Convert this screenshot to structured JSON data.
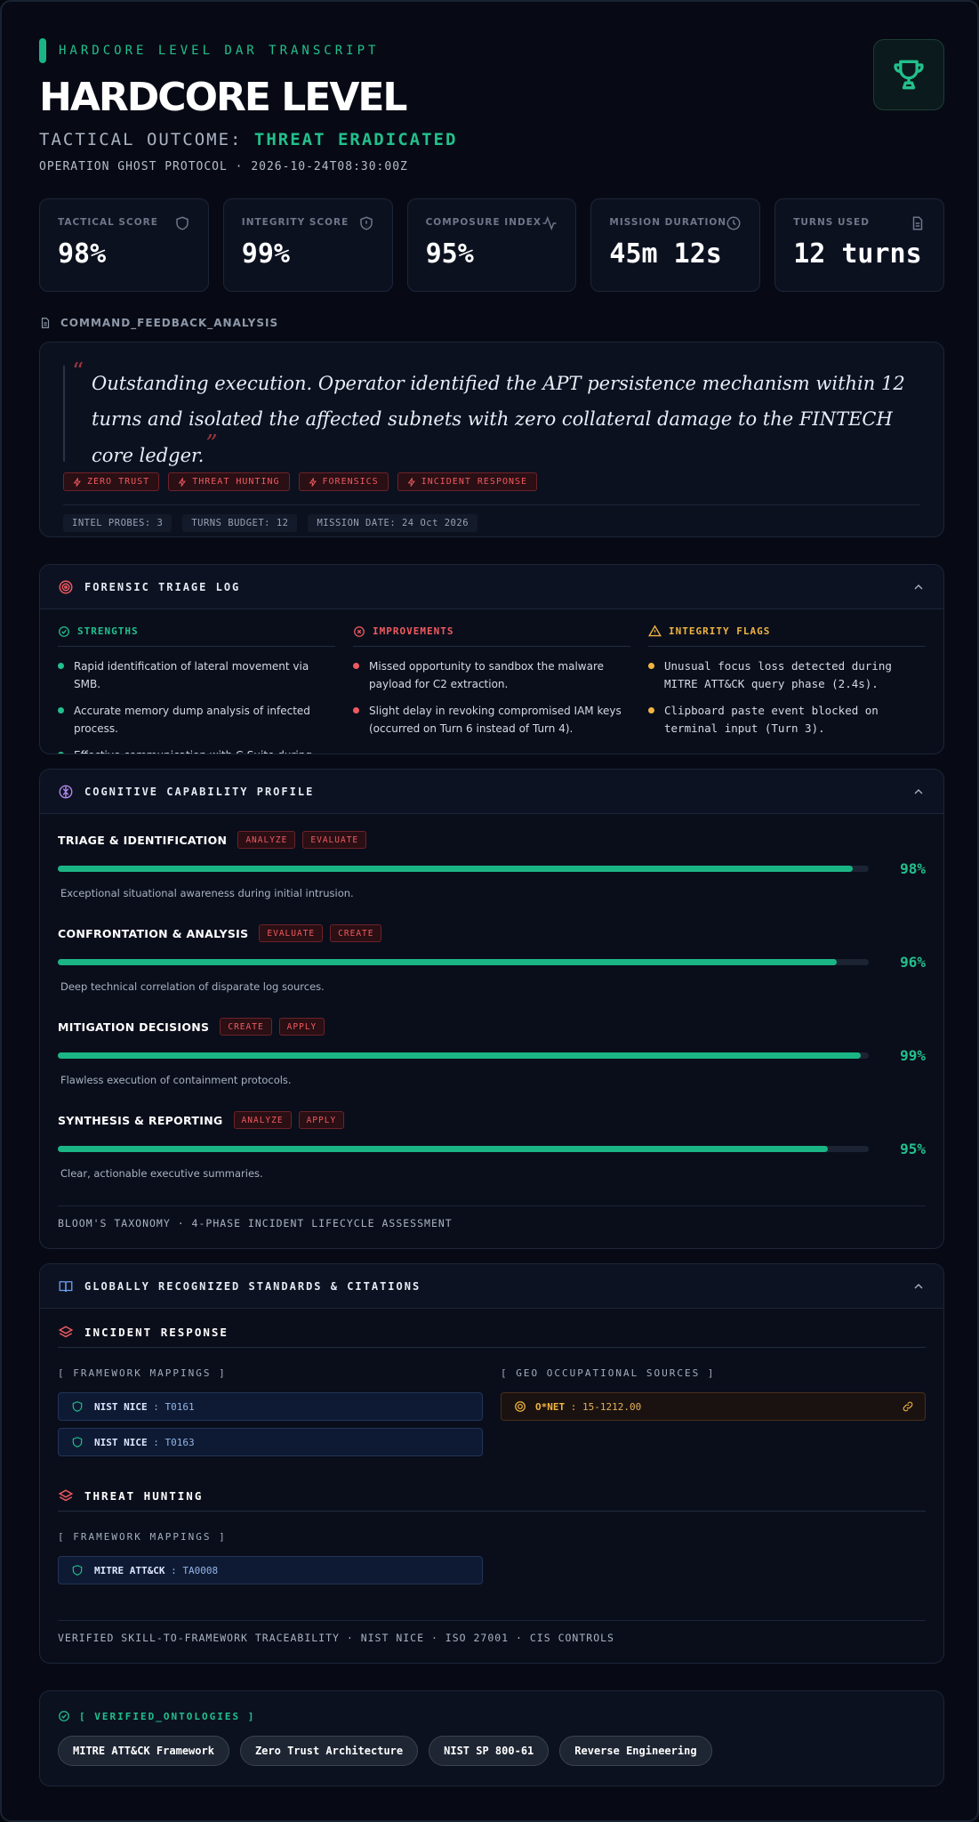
{
  "header": {
    "eyebrow": "HARDCORE LEVEL DAR TRANSCRIPT",
    "title": "HARDCORE LEVEL",
    "outcome_label": "TACTICAL OUTCOME:",
    "outcome_value": "THREAT ERADICATED",
    "operation_line": "OPERATION GHOST PROTOCOL · 2026-10-24T08:30:00Z",
    "accent_color": "#22c08c"
  },
  "stats": [
    {
      "label": "TACTICAL SCORE",
      "value": "98%",
      "icon": "shield-icon"
    },
    {
      "label": "INTEGRITY SCORE",
      "value": "99%",
      "icon": "shield-alert-icon"
    },
    {
      "label": "COMPOSURE INDEX",
      "value": "95%",
      "icon": "activity-icon"
    },
    {
      "label": "MISSION DURATION",
      "value": "45m 12s",
      "icon": "clock-icon"
    },
    {
      "label": "TURNS USED",
      "value": "12 turns",
      "icon": "document-icon"
    }
  ],
  "feedback": {
    "section_label": "COMMAND_FEEDBACK_ANALYSIS",
    "quote_open": "“",
    "quote_close": "”",
    "quote": "Outstanding execution. Operator identified the APT persistence mechanism within 12 turns and isolated the affected subnets with zero collateral damage to the FINTECH core ledger.",
    "tags": [
      "ZERO TRUST",
      "THREAT HUNTING",
      "FORENSICS",
      "INCIDENT RESPONSE"
    ],
    "meta": [
      "INTEL PROBES: 3",
      "TURNS BUDGET: 12",
      "MISSION DATE: 24 Oct 2026"
    ]
  },
  "triage": {
    "title": "FORENSIC TRIAGE LOG",
    "strengths": {
      "title": "STRENGTHS",
      "color": "#22c08c",
      "items": [
        "Rapid identification of lateral movement via SMB.",
        "Accurate memory dump analysis of infected process.",
        "Effective communication with C-Suite during crisis."
      ]
    },
    "improvements": {
      "title": "IMPROVEMENTS",
      "color": "#ef5a5f",
      "items": [
        "Missed opportunity to sandbox the malware payload for C2 extraction.",
        "Slight delay in revoking compromised IAM keys (occurred on Turn 6 instead of Turn 4)."
      ]
    },
    "flags": {
      "title": "INTEGRITY FLAGS",
      "color": "#f0b440",
      "items": [
        "Unusual focus loss detected during MITRE ATT&CK query phase (2.4s).",
        "Clipboard paste event blocked on terminal input (Turn 3)."
      ]
    }
  },
  "cognitive": {
    "title": "COGNITIVE CAPABILITY PROFILE",
    "skills": [
      {
        "name": "TRIAGE & IDENTIFICATION",
        "chips": [
          "ANALYZE",
          "EVALUATE"
        ],
        "percent": 98,
        "percent_label": "98%",
        "desc": "Exceptional situational awareness during initial intrusion."
      },
      {
        "name": "CONFRONTATION & ANALYSIS",
        "chips": [
          "EVALUATE",
          "CREATE"
        ],
        "percent": 96,
        "percent_label": "96%",
        "desc": "Deep technical correlation of disparate log sources."
      },
      {
        "name": "MITIGATION DECISIONS",
        "chips": [
          "CREATE",
          "APPLY"
        ],
        "percent": 99,
        "percent_label": "99%",
        "desc": "Flawless execution of containment protocols."
      },
      {
        "name": "SYNTHESIS & REPORTING",
        "chips": [
          "ANALYZE",
          "APPLY"
        ],
        "percent": 95,
        "percent_label": "95%",
        "desc": "Clear, actionable executive summaries."
      }
    ],
    "footer": "BLOOM'S TAXONOMY · 4-PHASE INCIDENT LIFECYCLE ASSESSMENT"
  },
  "standards": {
    "title": "GLOBALLY RECOGNIZED STANDARDS & CITATIONS",
    "groups": [
      {
        "name": "INCIDENT RESPONSE",
        "mappings_label": "[ FRAMEWORK MAPPINGS ]",
        "mappings": [
          {
            "framework": "NIST NICE",
            "code": ": T0161"
          },
          {
            "framework": "NIST NICE",
            "code": ": T0163"
          }
        ],
        "sources_label": "[ GEO OCCUPATIONAL SOURCES ]",
        "sources": [
          {
            "framework": "O*NET",
            "code": ": 15-1212.00"
          }
        ]
      },
      {
        "name": "THREAT HUNTING",
        "mappings_label": "[ FRAMEWORK MAPPINGS ]",
        "mappings": [
          {
            "framework": "MITRE ATT&CK",
            "code": ": TA0008"
          }
        ]
      }
    ],
    "footer": "VERIFIED SKILL-TO-FRAMEWORK TRACEABILITY · NIST NICE · ISO 27001 · CIS CONTROLS"
  },
  "ontologies": {
    "title": "[ VERIFIED_ONTOLOGIES ]",
    "items": [
      "MITRE ATT&CK Framework",
      "Zero Trust Architecture",
      "NIST SP 800-61",
      "Reverse Engineering"
    ]
  }
}
